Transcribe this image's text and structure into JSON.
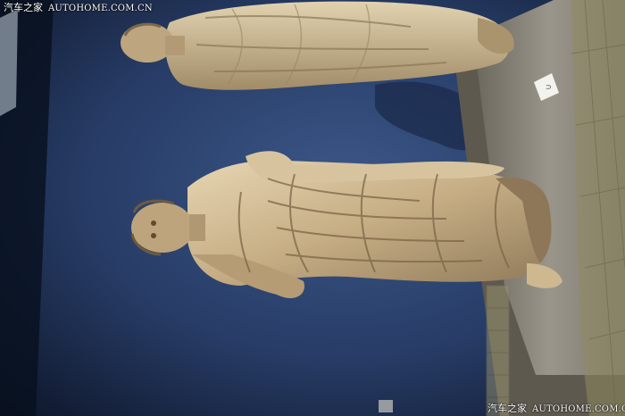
{
  "image": {
    "subject": "Two rotated marble draped statues displayed on plinths against a blue museum wall",
    "watermark": {
      "cn_text": "汽车之家",
      "en_text": "AUTOHOME.COM.CN"
    },
    "colors": {
      "wall_blue": "#2a4070",
      "marble": "#c8b48e",
      "plinth_stone": "#8a8478",
      "label_card": "#f2f2ee"
    }
  }
}
